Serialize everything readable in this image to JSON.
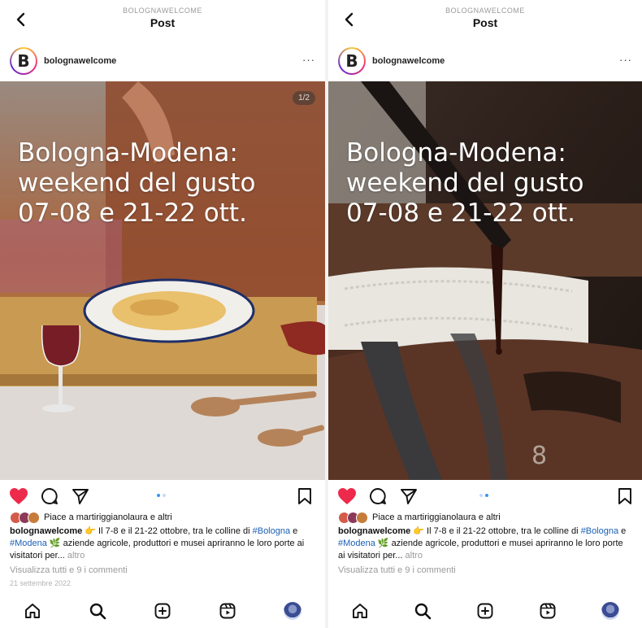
{
  "left": {
    "top_account": "BOLOGNAWELCOME",
    "top_title": "Post",
    "username": "bolognawelcome",
    "more": "···",
    "overlay_lines": [
      "Bologna-Modena:",
      "weekend del gusto",
      "07-08 e 21-22 ott."
    ],
    "counter": "1/2",
    "likes_text": "Piace a martiriggianolaura e altri",
    "caption_user": "bolognawelcome",
    "caption_part1": " 👉 Il 7-8 e il 21-22 ottobre, tra le colline di ",
    "tag1": "#Bologna",
    "caption_part2": " e ",
    "tag2": "#Modena",
    "caption_part3": " 🌿 aziende agricole, produttori e musei apriranno le loro porte ai visitatori per... ",
    "more_link": "altro",
    "comments": "Visualizza tutti e 9 i commenti",
    "date": "21 settembre 2022"
  },
  "right": {
    "top_account": "BOLOGNAWELCOME",
    "top_title": "Post",
    "username": "bolognawelcome",
    "more": "···",
    "overlay_lines": [
      "Bologna-Modena:",
      "weekend del gusto",
      "07-08 e 21-22 ott."
    ],
    "likes_text": "Piace a martiriggianolaura e altri",
    "caption_user": "bolognawelcome",
    "caption_part1": " 👉 Il 7-8 e il 21-22 ottobre, tra le colline di ",
    "tag1": "#Bologna",
    "caption_part2": " e ",
    "tag2": "#Modena",
    "caption_part3": " 🌿 aziende agricole, produttori e musei apriranno le loro porte ai visitatori per... ",
    "more_link": "altro",
    "comments": "Visualizza tutti e 9 i commenti"
  },
  "icons": {
    "back": "chevron-left-icon",
    "like": "heart-icon",
    "comment": "comment-icon",
    "share": "send-icon",
    "save": "bookmark-icon",
    "home": "home-icon",
    "search": "search-icon",
    "create": "plus-square-icon",
    "reels": "reels-icon",
    "profile": "profile-avatar"
  },
  "colors": {
    "like": "#ed2a4b",
    "tag": "#1a5fb4",
    "dot_active": "#3897f0"
  }
}
